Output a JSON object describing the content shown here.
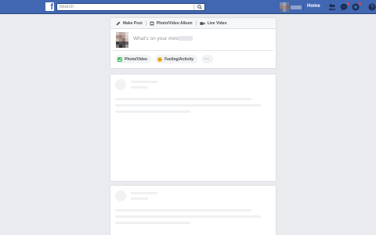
{
  "topbar": {
    "logo": "f",
    "search_placeholder": "Search",
    "home_label": "Home",
    "icons": [
      "friend-requests-icon",
      "messages-icon",
      "notifications-icon",
      "help-icon"
    ],
    "colors": {
      "bar": "#4267b2",
      "badge": "#fa3e3e"
    }
  },
  "composer": {
    "tabs": [
      {
        "label": "Make Post",
        "icon": "pencil-icon"
      },
      {
        "label": "Photo/Video Album",
        "icon": "album-icon"
      },
      {
        "label": "Live Video",
        "icon": "video-camera-icon"
      }
    ],
    "placeholder": "What's on your mind,",
    "actions": [
      {
        "label": "Photo/Video",
        "icon": "photo-icon",
        "color": "#45bd62"
      },
      {
        "label": "Feeling/Activity",
        "icon": "smiley-icon",
        "color": "#f7b928"
      },
      {
        "label": "···",
        "icon": "more-icon"
      }
    ]
  }
}
